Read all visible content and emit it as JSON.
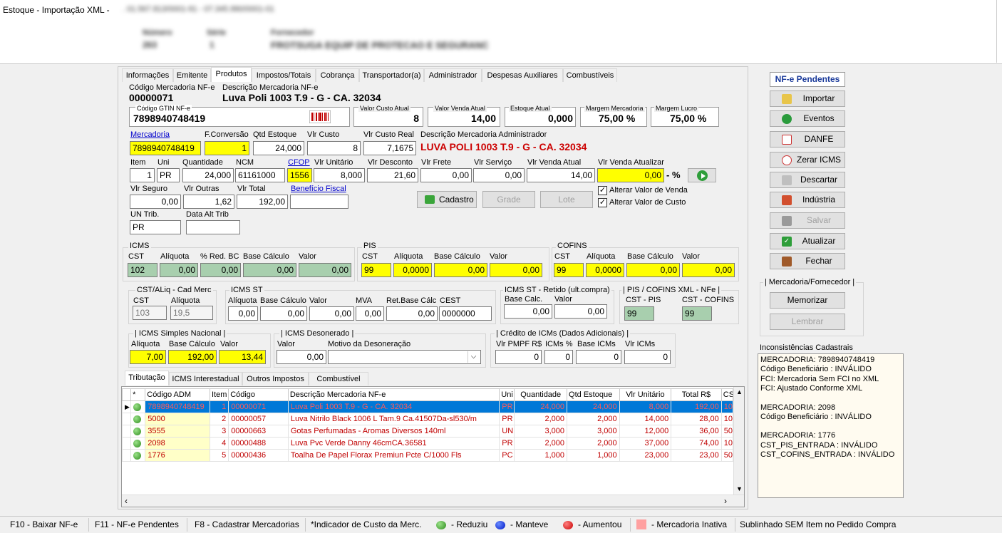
{
  "window": {
    "title": "Estoque - Importação XML  -",
    "title_blur": ". 01.567.813/0001-91 - 07.345.990/0001-01",
    "h1": "Número",
    "h1v": "263",
    "h2": "Série",
    "h2v": "1",
    "h3": "Fornecedor",
    "h3v": "FROTSUGA EQUIP DE PROTECAO E SEGURANC"
  },
  "tabs": [
    "Informações",
    "Emitente",
    "Produtos",
    "Impostos/Totais",
    "Cobrança",
    "Transportador(a)",
    "Administrador",
    "Despesas Auxiliares",
    "Combustíveis"
  ],
  "prod": {
    "cod_label": "Código Mercadoria NF-e",
    "cod": "00000071",
    "desc_label": "Descrição Mercadoria NF-e",
    "desc": "Luva Poli 1003 T.9 - G - CA. 32034",
    "gtin_label": "Código GTIN NF-e",
    "gtin": "7898940748419",
    "vca_label": "Valor Custo Atual",
    "vca": "8",
    "vva_label": "Valor Venda Atual",
    "vva": "14,00",
    "ea_label": "Estoque Atual",
    "ea": "0,000",
    "mm_label": "Margem Mercadoria",
    "mm": "75,00 %",
    "ml_label": "Margem Lucro",
    "ml": "75,00 %",
    "merc_label": "Mercadoria",
    "merc": "7898940748419",
    "fconv_label": "F.Conversão",
    "fconv": "1",
    "qtdest_label": "Qtd Estoque",
    "qtdest": "24,000",
    "vcusto_label": "Vlr Custo",
    "vcusto": "8",
    "vcr_label": "Vlr Custo Real",
    "vcr": "7,1675",
    "dadm_label": "Descrição Mercadoria Administrador",
    "dadm": "LUVA POLI 1003 T.9 - G - CA. 32034",
    "item_label": "Item",
    "item": "1",
    "uni_label": "Uni",
    "uni": "PR",
    "qtd_label": "Quantidade",
    "qtd": "24,000",
    "ncm_label": "NCM",
    "ncm": "61161000",
    "cfop_label": "CFOP",
    "cfop": "1556",
    "vunit_label": "Vlr Unitário",
    "vunit": "8,000",
    "vdesc_label": "Vlr Desconto",
    "vdesc": "21,60",
    "vfrete_label": "Vlr Frete",
    "vfrete": "0,00",
    "vserv_label": "Vlr Serviço",
    "vserv": "0,00",
    "vvat_label": "Vlr Venda Atual",
    "vvat": "14,00",
    "vvaz_label": "Vlr Venda Atualizar",
    "vvaz": "0,00",
    "pct": "- %",
    "vseg_label": "Vlr Seguro",
    "vseg": "0,00",
    "vout_label": "Vlr Outras",
    "vout": "1,62",
    "vtot_label": "Vlr Total",
    "vtot": "192,00",
    "bf_label": "Benefício Fiscal",
    "cadastro": "Cadastro",
    "grade": "Grade",
    "lote": "Lote",
    "chk1": "Alterar Valor de Venda",
    "chk2": "Alterar Valor de Custo",
    "untrib_label": "UN Trib.",
    "untrib": "PR",
    "dat_label": "Data Alt Trib"
  },
  "icms": {
    "title": "ICMS",
    "cst_l": "CST",
    "aliq_l": "Alíquota",
    "red_l": "% Red. BC",
    "base_l": "Base Cálculo",
    "val_l": "Valor",
    "cst": "102",
    "aliq": "0,00",
    "red": "0,00",
    "base": "0,00",
    "val": "0,00"
  },
  "pis": {
    "title": "PIS",
    "cst_l": "CST",
    "aliq_l": "Alíquota",
    "base_l": "Base Cálculo",
    "val_l": "Valor",
    "cst": "99",
    "aliq": "0,0000",
    "base": "0,00",
    "val": "0,00"
  },
  "cofins": {
    "title": "COFINS",
    "cst_l": "CST",
    "aliq_l": "Alíquota",
    "base_l": "Base Cálculo",
    "val_l": "Valor",
    "cst": "99",
    "aliq": "0,0000",
    "base": "0,00",
    "val": "0,00"
  },
  "cstaliq": {
    "title": "CST/ALiq - Cad Merc",
    "cst_l": "CST",
    "aliq_l": "Alíquota",
    "cst": "103",
    "aliq": "19,5"
  },
  "icmsst": {
    "title": "ICMS ST",
    "aliq_l": "Alíquota",
    "base_l": "Base Cálculo",
    "val_l": "Valor",
    "mva_l": "MVA",
    "ret_l": "Ret.Base Cálc",
    "cest_l": "CEST",
    "aliq": "0,00",
    "base": "0,00",
    "val": "0,00",
    "mva": "0,00",
    "ret": "0,00",
    "cest": "0000000"
  },
  "retido": {
    "title": "ICMS ST - Retido (ult.compra)",
    "base_l": "Base Calc.",
    "val_l": "Valor",
    "base": "0,00",
    "val": "0,00"
  },
  "pisxml": {
    "title": "| PIS / COFINS XML - NFe |",
    "pis_l": "CST - PIS",
    "cof_l": "CST - COFINS",
    "pis": "99",
    "cof": "99"
  },
  "simples": {
    "title": "| ICMS Simples Nacional |",
    "aliq_l": "Alíquota",
    "base_l": "Base Cálculo",
    "val_l": "Valor",
    "aliq": "7,00",
    "base": "192,00",
    "val": "13,44"
  },
  "deson": {
    "title": "| ICMS Desonerado |",
    "val_l": "Valor",
    "mot_l": "Motivo da Desoneração",
    "val": "0,00"
  },
  "credito": {
    "title": "| Crédito de ICMs (Dados Adicionais) |",
    "pmpf_l": "Vlr PMPF R$",
    "icmsp_l": "ICMs %",
    "base_l": "Base ICMs",
    "vicms_l": "Vlr ICMs",
    "pmpf": "0",
    "icmsp": "0",
    "base": "0",
    "vicms": "0"
  },
  "subtabs": [
    "Tributação",
    "ICMS Interestadual",
    "Outros Impostos",
    "Combustível"
  ],
  "grid": {
    "headers": [
      "*",
      "Código ADM",
      "Item",
      "Código",
      "Descrição Mercadoria NF-e",
      "Uni",
      "Quantidade",
      "Qtd Estoque",
      "Vlr Unitário",
      "Total R$",
      "CS"
    ],
    "rows": [
      {
        "adm": "7898940748419",
        "item": "1",
        "cod": "00000071",
        "desc": "Luva Poli 1003 T.9 - G - CA. 32034",
        "uni": "PR",
        "qtd": "24,000",
        "est": "24,000",
        "vu": "8,000",
        "tot": "192,00",
        "cs": "10"
      },
      {
        "adm": "5000",
        "item": "2",
        "cod": "00000057",
        "desc": "Luva Nitrilo Black 1006 L Tam.9 Ca.41507Da-sl530/m",
        "uni": "PR",
        "qtd": "2,000",
        "est": "2,000",
        "vu": "14,000",
        "tot": "28,00",
        "cs": "10"
      },
      {
        "adm": "3555",
        "item": "3",
        "cod": "00000663",
        "desc": "Gotas Perfumadas - Aromas Diversos 140ml",
        "uni": "UN",
        "qtd": "3,000",
        "est": "3,000",
        "vu": "12,000",
        "tot": "36,00",
        "cs": "50"
      },
      {
        "adm": "2098",
        "item": "4",
        "cod": "00000488",
        "desc": "Luva Pvc Verde Danny 46cmCA.36581",
        "uni": "PR",
        "qtd": "2,000",
        "est": "2,000",
        "vu": "37,000",
        "tot": "74,00",
        "cs": "10"
      },
      {
        "adm": "1776",
        "item": "5",
        "cod": "00000436",
        "desc": "Toalha De Papel Florax Premiun Pcte C/1000 Fls",
        "uni": "PC",
        "qtd": "1,000",
        "est": "1,000",
        "vu": "23,000",
        "tot": "23,00",
        "cs": "50"
      }
    ]
  },
  "side": {
    "header": "NF-e Pendentes",
    "importar": "Importar",
    "eventos": "Eventos",
    "danfe": "DANFE",
    "zerar": "Zerar ICMS",
    "descartar": "Descartar",
    "industria": "Indústria",
    "salvar": "Salvar",
    "atualizar": "Atualizar",
    "fechar": "Fechar",
    "mf_title": "| Mercadoria/Fornecedor |",
    "memorizar": "Memorizar",
    "lembrar": "Lembrar",
    "inc_title": "Inconsistências Cadastrais",
    "inc_lines": [
      "MERCADORIA: 7898940748419",
      "Código Beneficiário : INVÁLIDO",
      "FCI: Mercadoria Sem FCI no XML",
      "FCI: Ajustado Conforme XML",
      "",
      "MERCADORIA: 2098",
      "Código Beneficiário : INVÁLIDO",
      "",
      "MERCADORIA: 1776",
      "CST_PIS_ENTRADA : INVÁLIDO",
      "CST_COFINS_ENTRADA : INVÁLIDO"
    ]
  },
  "status": {
    "f10": "F10 - Baixar NF-e",
    "f11": "F11 - NF-e Pendentes",
    "f8": "F8 - Cadastrar Mercadorias",
    "ind": "*Indicador de Custo da Merc.",
    "reduziu": "- Reduziu",
    "manteve": "- Manteve",
    "aumentou": "- Aumentou",
    "inativa": "- Mercadoria Inativa",
    "sublinhado": "Sublinhado SEM Item no Pedido Compra"
  }
}
